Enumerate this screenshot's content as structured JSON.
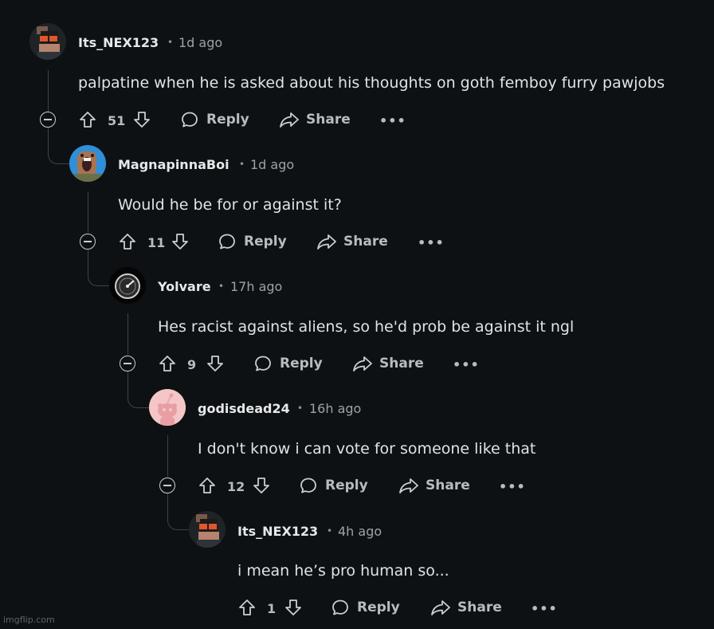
{
  "actions": {
    "reply": "Reply",
    "share": "Share",
    "more": "•••"
  },
  "comments": [
    {
      "username": "Its_NEX123",
      "dot": "•",
      "time": "1d ago",
      "body": "palpatine when he is asked about his thoughts on goth femboy furry pawjobs",
      "votes": "51"
    },
    {
      "username": "MagnapinnaBoi",
      "dot": "•",
      "time": "1d ago",
      "body": "Would he be for or against it?",
      "votes": "11"
    },
    {
      "username": "Yolvare",
      "dot": "•",
      "time": "17h ago",
      "body": "Hes racist against aliens, so he'd prob be against it ngl",
      "votes": "9"
    },
    {
      "username": "godisdead24",
      "dot": "•",
      "time": "16h ago",
      "body": "I don't know i can vote for someone like that",
      "votes": "12"
    },
    {
      "username": "Its_NEX123",
      "dot": "•",
      "time": "4h ago",
      "body": "i mean he’s pro human so...",
      "votes": "1"
    }
  ],
  "watermark": "imgflip.com"
}
